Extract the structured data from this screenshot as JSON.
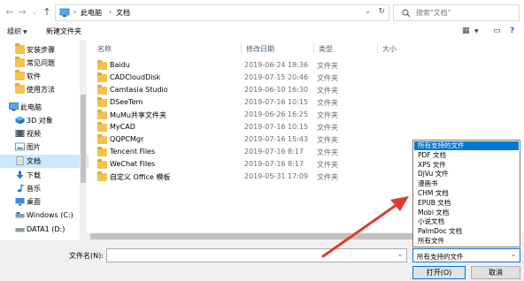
{
  "address": {
    "crumbs": [
      "此电脑",
      "文档"
    ],
    "separator": "›"
  },
  "search": {
    "placeholder": "搜索\"文档\""
  },
  "toolbar": {
    "organize": "组织",
    "new_folder": "新建文件夹"
  },
  "nav": {
    "items": [
      {
        "label": "安装步骤",
        "icon": "folder-icon"
      },
      {
        "label": "常见问题",
        "icon": "folder-icon"
      },
      {
        "label": "软件",
        "icon": "folder-icon"
      },
      {
        "label": "使用方法",
        "icon": "folder-icon"
      },
      {
        "label": "此电脑",
        "icon": "computer-icon"
      },
      {
        "label": "3D 对象",
        "icon": "3d-objects-icon"
      },
      {
        "label": "视频",
        "icon": "video-icon"
      },
      {
        "label": "图片",
        "icon": "pictures-icon"
      },
      {
        "label": "文档",
        "icon": "documents-icon",
        "selected": true
      },
      {
        "label": "下载",
        "icon": "download-icon"
      },
      {
        "label": "音乐",
        "icon": "music-icon"
      },
      {
        "label": "桌面",
        "icon": "desktop-icon"
      },
      {
        "label": "Windows (C:)",
        "icon": "drive-icon"
      },
      {
        "label": "DATA1 (D:)",
        "icon": "drive-icon"
      }
    ]
  },
  "columns": {
    "name": "名称",
    "date": "修改日期",
    "type": "类型",
    "size": "大小"
  },
  "files": [
    {
      "name": "Baidu",
      "date": "2019-06-24 18:36",
      "type": "文件夹"
    },
    {
      "name": "CADCloudDisk",
      "date": "2019-07-15 20:46",
      "type": "文件夹"
    },
    {
      "name": "Camtasia Studio",
      "date": "2019-06-10 16:30",
      "type": "文件夹"
    },
    {
      "name": "DSeeTem",
      "date": "2019-07-16 10:15",
      "type": "文件夹"
    },
    {
      "name": "MuMu共享文件夹",
      "date": "2019-06-26 16:25",
      "type": "文件夹"
    },
    {
      "name": "MyCAD",
      "date": "2019-07-16 10:15",
      "type": "文件夹"
    },
    {
      "name": "QQPCMgr",
      "date": "2019-07-16 15:43",
      "type": "文件夹"
    },
    {
      "name": "Tencent Files",
      "date": "2019-07-16 8:17",
      "type": "文件夹"
    },
    {
      "name": "WeChat Files",
      "date": "2019-07-16 8:17",
      "type": "文件夹"
    },
    {
      "name": "自定义 Office 模板",
      "date": "2019-05-31 17:09",
      "type": "文件夹"
    }
  ],
  "filetypes": [
    "所有支持的文件",
    "PDF 文档",
    "XPS 文件",
    "DjVu 文件",
    "漫画书",
    "CHM 文档",
    "EPUB 文档",
    "Mobi 文档",
    "小说文档",
    "PalmDoc 文档",
    "所有文件"
  ],
  "filetypes_selected": 0,
  "bottom": {
    "filename_label": "文件名(N):",
    "filename_value": "",
    "filetype_value": "所有支持的文件",
    "open_label": "打开(O)",
    "cancel_label": "取消"
  },
  "colors": {
    "selection": "#cce8ff",
    "dropdown_highlight": "#0078d7",
    "folder": "#f4c24e",
    "annotation_arrow": "#e03a2f"
  }
}
